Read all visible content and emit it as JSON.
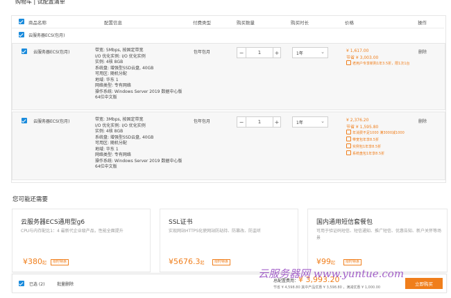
{
  "header": {
    "breadcrumb": "购物车  |  试配置清单"
  },
  "columns": [
    "商品名称",
    "配置信息",
    "付费类型",
    "购买数量",
    "购买时长",
    "价格",
    "操作"
  ],
  "group_label": "云服务器ECS(包月)",
  "items": [
    {
      "name": "云服务器ECS(包月)",
      "config": [
        "带宽: 5Mbps, 按固定带宽",
        "I/O 优化实例: I/O 优化实例",
        "实例: 4核 8GB",
        "系统盘: 增强型SSD云盘, 40GB",
        "可用区: 随机分配",
        "地域: 华东 1",
        "网络类型: 专有网络",
        "操作系统: Windows Server 2019 数据中心版",
        "64位中文版"
      ],
      "pay_type": "包年包月",
      "quantity": "1",
      "duration": "1年",
      "price": "¥ 1,617.00",
      "save": "节省 ¥ 3,003.00",
      "promos": [
        "老用户专享新购1年3.5折，限1次1台"
      ],
      "action": "删除"
    },
    {
      "name": "云服务器ECS(包月)",
      "config": [
        "带宽: 3Mbps, 按固定带宽",
        "I/O 优化实例: I/O 优化实例",
        "实例: 4核 8GB",
        "系统盘: 增强型SSD云盘, 40GB",
        "可用区: 随机分配",
        "地域: 华东 1",
        "网络类型: 专有网络",
        "操作系统: Windows Server 2019 数据中心版",
        "64位中文版"
      ],
      "pay_type": "包年包月",
      "quantity": "1",
      "duration": "1年",
      "price": "¥ 2,376.20",
      "save": "节省 ¥ 1,595.80",
      "promos": [
        "年消费不足1000 满3000减1000",
        "带宽包年享8.5折",
        "实例包1年享8.5折",
        "系统盘包1年享8.5折"
      ],
      "action": "删除"
    }
  ],
  "recommend": {
    "title": "您可能还需要",
    "cards": [
      {
        "title": "云服务器ECS通用型g6",
        "desc": "CPU与内存配比1：4 最新代企业级产品，性能全面提升",
        "price": "¥380",
        "unit": "起",
        "tag": "限时特惠"
      },
      {
        "title": "SSL证书",
        "desc": "实现网站HTTPS化使网站防劫持、防篡改、防监听",
        "price": "¥5676.3",
        "unit": "起",
        "tag": "限时特惠"
      },
      {
        "title": "国内通用短信套餐包",
        "desc": "可用于验证码短信、短信通知、推广短信、优惠告知、新户关怀等场景",
        "price": "¥99",
        "unit": "起",
        "tag": "限时特惠"
      }
    ]
  },
  "footer": {
    "selected": "已选 (2)",
    "batch_delete": "批量删除",
    "total_label": "总配置费用：",
    "total": "¥ 3,993.20",
    "savings": "节省 ¥ 4,598.80 其中产品优惠 ¥ 3,598.80 ，满减优惠 ¥ 1,000.00",
    "buy": "立即购买",
    "watermark": "云服务器网 www.yuntue.com"
  },
  "colors": {
    "accent": "#f07e1b",
    "checkbox": "#1a8bdc"
  }
}
